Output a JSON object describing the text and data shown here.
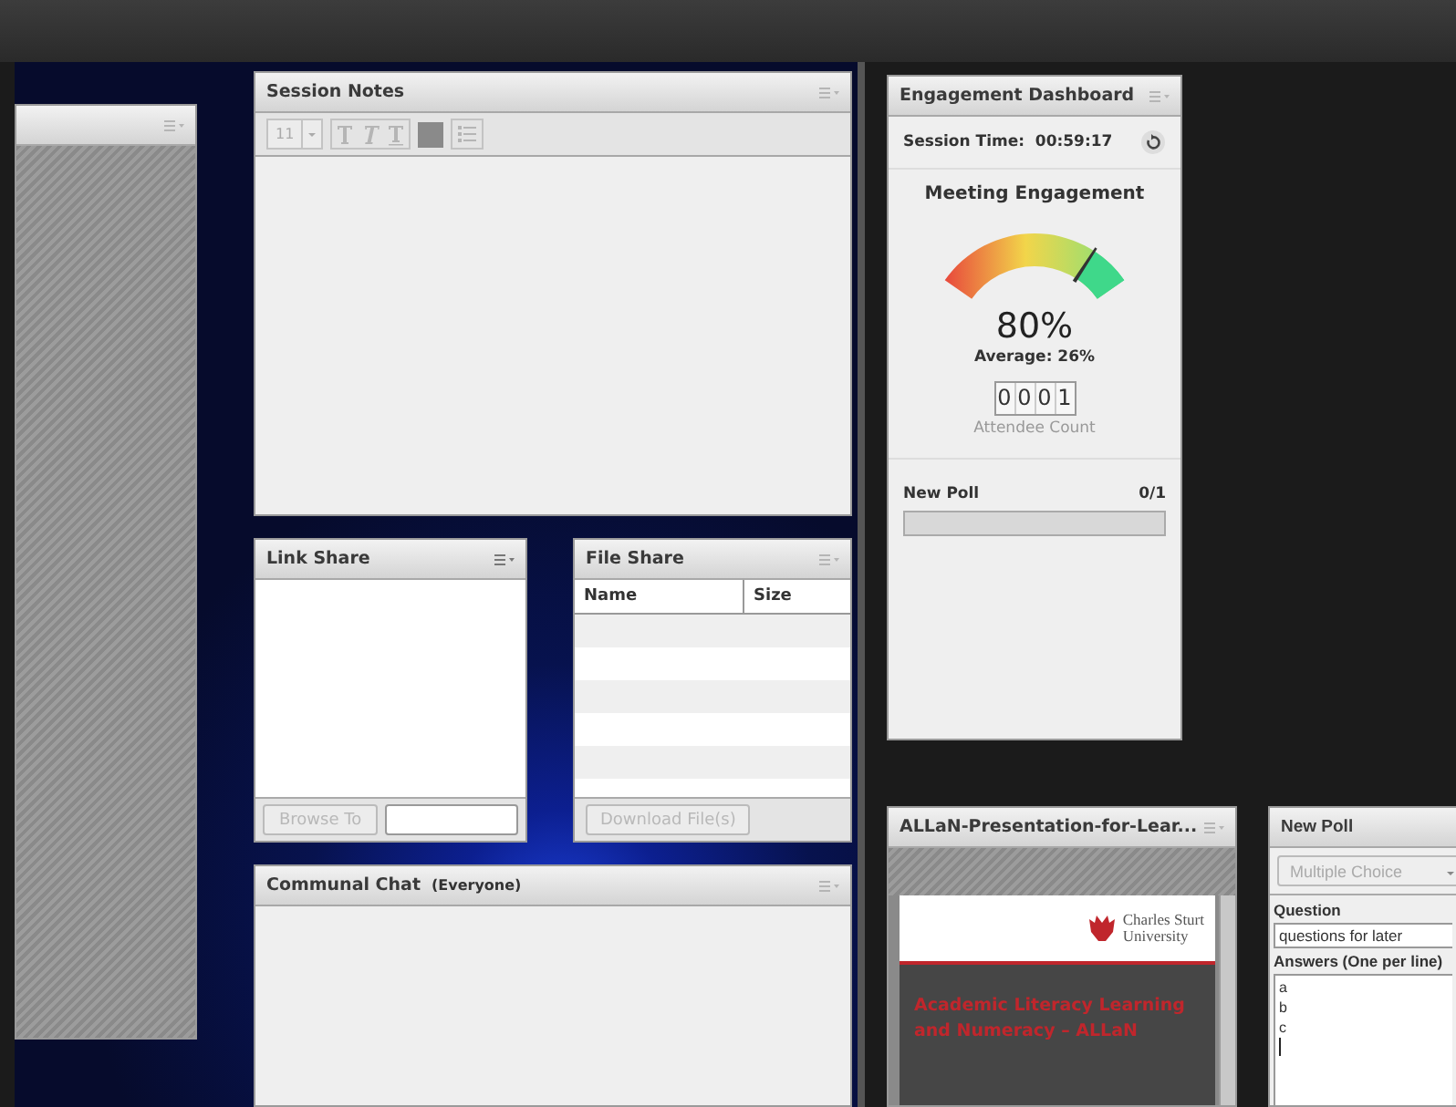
{
  "session_notes": {
    "title": "Session Notes",
    "font_size": "11"
  },
  "link_share": {
    "title": "Link Share",
    "browse_button": "Browse To",
    "browse_disabled": true
  },
  "file_share": {
    "title": "File Share",
    "columns": [
      "Name",
      "Size"
    ],
    "download_button": "Download File(s)",
    "download_disabled": true
  },
  "chat": {
    "title": "Communal Chat",
    "audience": "(Everyone)"
  },
  "engagement": {
    "title": "Engagement Dashboard",
    "session_time_label": "Session Time:",
    "session_time": "00:59:17",
    "heading": "Meeting Engagement",
    "meter": {
      "level": 0.8
    },
    "percent": "80%",
    "average": "Average: 26%",
    "attendee_digits": [
      "0",
      "0",
      "0",
      "1"
    ],
    "attendee_label": "Attendee Count",
    "poll": {
      "name": "New Poll",
      "count": "0/1",
      "level": 0
    }
  },
  "presentation": {
    "title": "ALLaN-Presentation-for-Lear...",
    "logo_lines": [
      "Charles Sturt",
      "University"
    ],
    "slide_title": "Academic Literacy Learning and Numeracy – ALLaN"
  },
  "new_poll": {
    "title": "New Poll",
    "type": "Multiple Choice",
    "type_disabled": true,
    "question_label": "Question",
    "question": "questions for later",
    "answers_label": "Answers (One per line)",
    "answers": [
      "a",
      "b",
      "c"
    ]
  }
}
